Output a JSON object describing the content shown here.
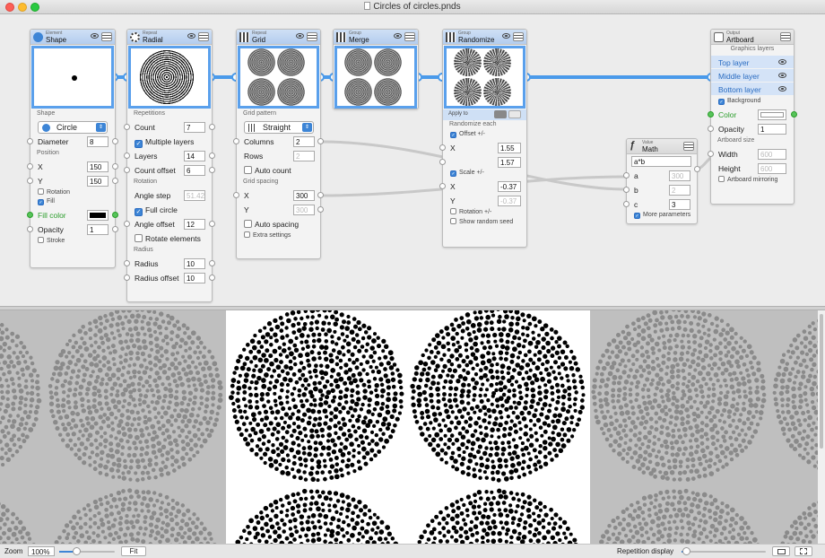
{
  "window": {
    "title": "Circles of circles.pnds"
  },
  "colors": {
    "accent": "#3d85d6",
    "link": "#4a9aea",
    "fill": "#000000"
  },
  "nodes": {
    "shape": {
      "category": "Element",
      "name": "Shape",
      "section_shape": "Shape",
      "shape_value": "Circle",
      "diameter_label": "Diameter",
      "diameter": "8",
      "section_position": "Position",
      "x_label": "X",
      "x": "150",
      "y_label": "Y",
      "y": "150",
      "rotation_label": "Rotation",
      "fill_label": "Fill",
      "fill_color_label": "Fill color",
      "opacity_label": "Opacity",
      "opacity": "1",
      "stroke_label": "Stroke"
    },
    "radial": {
      "category": "Repeat",
      "name": "Radial",
      "section_repetitions": "Repetitions",
      "count_label": "Count",
      "count": "7",
      "multiple_layers_label": "Multiple layers",
      "layers_label": "Layers",
      "layers": "14",
      "count_offset_label": "Count offset",
      "count_offset": "6",
      "section_rotation": "Rotation",
      "angle_step_label": "Angle step",
      "angle_step": "51.42",
      "full_circle_label": "Full circle",
      "angle_offset_label": "Angle offset",
      "angle_offset": "12",
      "rotate_elements_label": "Rotate elements",
      "section_radius": "Radius",
      "radius_label": "Radius",
      "radius": "10",
      "radius_offset_label": "Radius offset",
      "radius_offset": "10"
    },
    "grid": {
      "category": "Repeat",
      "name": "Grid",
      "section_pattern": "Grid pattern",
      "pattern_value": "Straight",
      "columns_label": "Columns",
      "columns": "2",
      "rows_label": "Rows",
      "rows": "2",
      "auto_count_label": "Auto count",
      "section_spacing": "Grid spacing",
      "x_label": "X",
      "x": "300",
      "y_label": "Y",
      "y": "300",
      "auto_spacing_label": "Auto spacing",
      "extra_settings_label": "Extra settings"
    },
    "merge": {
      "category": "Group",
      "name": "Merge"
    },
    "randomize": {
      "category": "Group",
      "name": "Randomize",
      "apply_to_label": "Apply to",
      "section_each": "Randomize each",
      "offset_label": "Offset +/-",
      "x_label": "X",
      "x": "1.55",
      "y": "1.57",
      "scale_label": "Scale +/-",
      "x2_label": "X",
      "x2": "-0.37",
      "y2_label": "Y",
      "y2": "-0.37",
      "rotation_label": "Rotation +/-",
      "random_seed_label": "Show random seed"
    },
    "math": {
      "category": "Value",
      "name": "Math",
      "expression": "a*b",
      "a_label": "a",
      "a": "300",
      "b_label": "b",
      "b": "2",
      "c_label": "c",
      "c": "3",
      "more_label": "More parameters"
    },
    "artboard": {
      "category": "Output",
      "name": "Artboard",
      "section_layers": "Graphics layers",
      "layers": [
        "Top layer",
        "Middle layer",
        "Bottom layer"
      ],
      "background_label": "Background",
      "color_label": "Color",
      "opacity_label": "Opacity",
      "opacity": "1",
      "section_size": "Artboard size",
      "width_label": "Width",
      "width": "600",
      "height_label": "Height",
      "height": "600",
      "mirroring_label": "Artboard mirroring"
    }
  },
  "statusbar": {
    "zoom_label": "Zoom",
    "zoom_value": "100%",
    "zoom_level": 0.3,
    "fit_label": "Fit",
    "repetition_label": "Repetition display",
    "repetition_level": 0.05
  }
}
